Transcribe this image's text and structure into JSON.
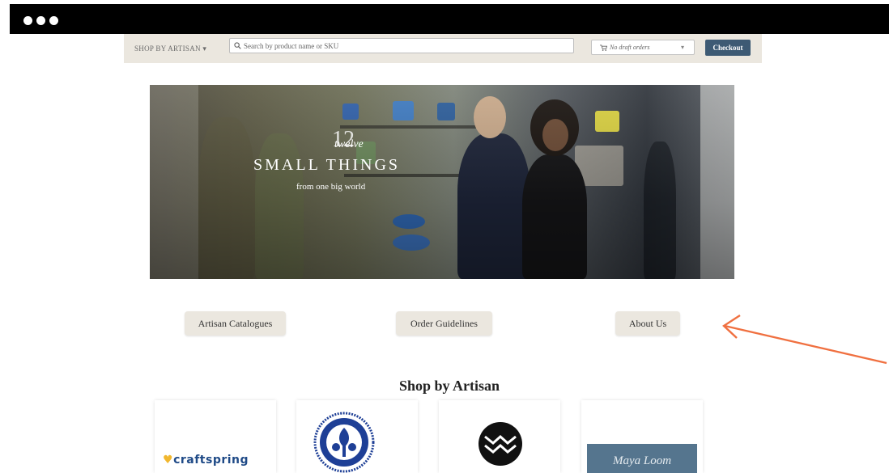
{
  "browser": {
    "controls": [
      "close",
      "minimize",
      "maximize"
    ]
  },
  "topbar": {
    "shop_by_artisan": "SHOP BY ARTISAN ",
    "search_placeholder": "Search by product name or SKU",
    "cart_text": "No draft orders",
    "checkout_label": "Checkout"
  },
  "hero": {
    "logo_number": "12",
    "logo_twelve": "twelve",
    "logo_title": "SMALL THINGS",
    "logo_sub": "from one big world"
  },
  "nav_buttons": [
    "Artisan Catalogues",
    "Order Guidelines",
    "About Us"
  ],
  "annotation": {
    "color": "#f07040"
  },
  "section": {
    "title": "Shop by Artisan"
  },
  "artisans": [
    {
      "logo_text": "craftspring",
      "name": "craftspring"
    },
    {
      "name": "seal-logo"
    },
    {
      "name": "chevron-mark-logo"
    },
    {
      "logo_text": "Maya Loom",
      "name": "maya-loom"
    }
  ],
  "colors": {
    "topbar_bg": "#ebe7df",
    "checkout_bg": "#3d5a74",
    "pill_bg": "#ebe7df"
  }
}
